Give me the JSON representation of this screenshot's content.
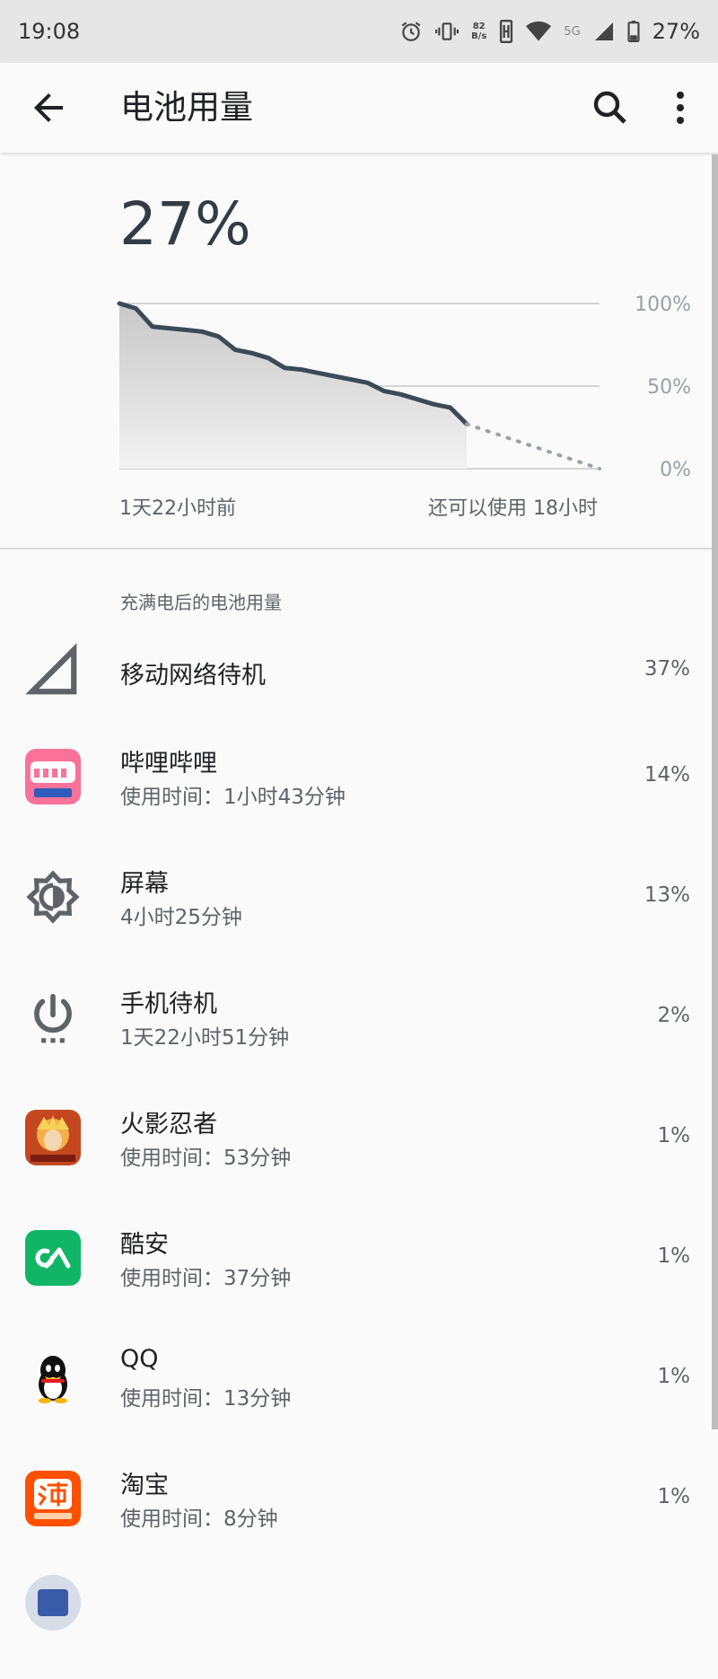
{
  "status_bar": {
    "time": "19:08",
    "net_speed_value": "82",
    "net_speed_unit": "B/s",
    "network_type": "5G",
    "battery_text": "27%"
  },
  "appbar": {
    "title": "电池用量"
  },
  "battery": {
    "level_text": "27%",
    "chart_labels": {
      "start": "1天22小时前",
      "remaining": "还可以使用 18小时"
    }
  },
  "chart_data": {
    "type": "area",
    "ylim": [
      0,
      100
    ],
    "y_ticks": [
      "100%",
      "50%",
      "0%"
    ],
    "x_start_label": "1天22小时前",
    "x_end_label": "还可以使用 18小时",
    "grid": true,
    "series": [
      {
        "values_history": [
          100,
          97,
          86,
          85,
          84,
          83,
          80,
          72,
          70,
          67,
          61,
          60,
          58,
          56,
          54,
          52,
          47,
          45,
          42,
          39,
          37,
          27
        ]
      },
      {
        "values_projection": [
          27,
          0
        ]
      }
    ]
  },
  "section_title": "充满电后的电池用量",
  "items": [
    {
      "icon": "signal-icon",
      "label": "移动网络待机",
      "sub": "",
      "percent": "37%"
    },
    {
      "icon": "bilibili-icon",
      "label": "哔哩哔哩",
      "sub": "使用时间：1小时43分钟",
      "percent": "14%",
      "color": "#fb7299"
    },
    {
      "icon": "brightness-icon",
      "label": "屏幕",
      "sub": "4小时25分钟",
      "percent": "13%"
    },
    {
      "icon": "power-icon",
      "label": "手机待机",
      "sub": "1天22小时51分钟",
      "percent": "2%"
    },
    {
      "icon": "naruto-icon",
      "label": "火影忍者",
      "sub": "使用时间：53分钟",
      "percent": "1%",
      "color": "#e8772e"
    },
    {
      "icon": "coolapk-icon",
      "label": "酷安",
      "sub": "使用时间：37分钟",
      "percent": "1%",
      "color": "#11b566"
    },
    {
      "icon": "qq-icon",
      "label": "QQ",
      "sub": "使用时间：13分钟",
      "percent": "1%"
    },
    {
      "icon": "taobao-icon",
      "label": "淘宝",
      "sub": "使用时间：8分钟",
      "percent": "1%",
      "color": "#ff5000"
    }
  ]
}
